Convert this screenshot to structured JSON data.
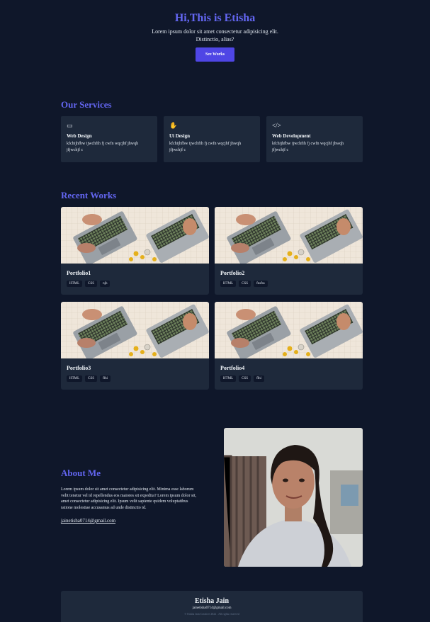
{
  "hero": {
    "title": "Hi,This is Etisha",
    "line1": "Lorem ipsum dolor sit amet consectetur adipisicing elit.",
    "line2": "Distinctio, alias?",
    "button": "See Works"
  },
  "services": {
    "title": "Our Services",
    "items": [
      {
        "icon": "browser-icon",
        "glyph": "▭",
        "name": "Web Design",
        "desc": "kfchijhfbw ijwchfih fj cwfn wqcjhf jhwqh jfjwchjf c"
      },
      {
        "icon": "hand-icon",
        "glyph": "✋",
        "name": "Ui Design",
        "desc": "kfchijhfbw ijwchfih fj cwfn wqcjhf jhwqh jfjwchjf c"
      },
      {
        "icon": "code-icon",
        "glyph": "</>",
        "name": "Web Development",
        "desc": "kfchijhfbw ijwchfih fj cwfn wqcjhf jhwqh jfjwchjf c"
      }
    ]
  },
  "works": {
    "title": "Recent Works",
    "items": [
      {
        "name": "Portfolio1",
        "tags": [
          "HTML",
          "CSS",
          "njh"
        ]
      },
      {
        "name": "Portfolio2",
        "tags": [
          "HTML",
          "CSS",
          "fnsfss"
        ]
      },
      {
        "name": "Portfolio3",
        "tags": [
          "HTML",
          "CSS",
          "flhi"
        ]
      },
      {
        "name": "Portfolio4",
        "tags": [
          "HTML",
          "CSS",
          "flhi"
        ]
      }
    ]
  },
  "about": {
    "title": "About Me",
    "text": "Lorem ipsum dolor sit amet consectetur adipisicing elit. Minima esse laborum velit tenetur vel id repellendus eos maiores sit expedita? Lorem ipsum dolor sit, amet consectetur adipisicing elit. Ipsum velit sapiente quidem voluptatibus ratione molestiae accusamus ad unde distinctio id.",
    "email": "jainetisha0714@gmail.com"
  },
  "footer": {
    "name": "Etisha Jain",
    "email": "jainetisha0714@gmail.com",
    "copyright": "© Etisha Jain Creative 2022 . All rights reserved"
  },
  "colors": {
    "bg": "#0f172a",
    "card": "#1e293b",
    "accent": "#6366f1",
    "button": "#4f46e5"
  }
}
